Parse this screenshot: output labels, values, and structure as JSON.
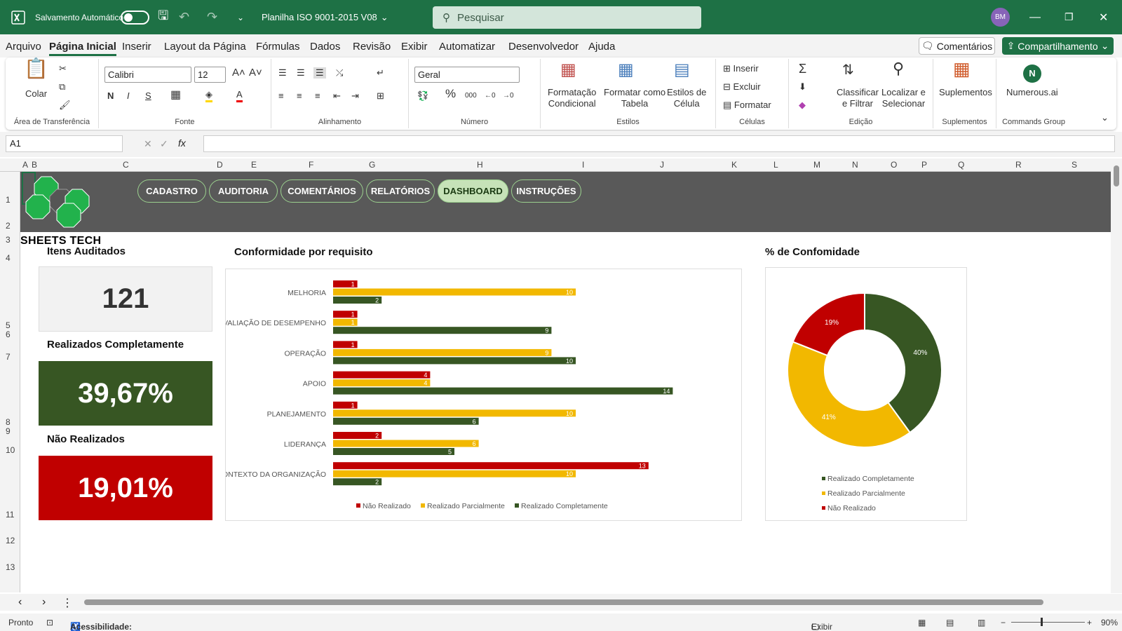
{
  "titlebar": {
    "autosave_label": "Salvamento Automático",
    "filename": "Planilha ISO 9001-2015 V08",
    "search_placeholder": "Pesquisar",
    "avatar": "BM"
  },
  "menu": [
    "Arquivo",
    "Página Inicial",
    "Inserir",
    "Layout da Página",
    "Fórmulas",
    "Dados",
    "Revisão",
    "Exibir",
    "Automatizar",
    "Desenvolvedor",
    "Ajuda"
  ],
  "menu_active": "Página Inicial",
  "comments_label": "Comentários",
  "share_label": "Compartilhamento",
  "ribbon": {
    "clipboard": {
      "paste": "Colar",
      "group": "Área de Transferência"
    },
    "font": {
      "name": "Calibri",
      "size": "12",
      "group": "Fonte",
      "bold": "N",
      "italic": "I",
      "underline": "S"
    },
    "alignment": {
      "group": "Alinhamento"
    },
    "number": {
      "format": "Geral",
      "group": "Número",
      "percent": "%",
      "thousands": "000"
    },
    "styles": {
      "cond1": "Formatação",
      "cond2": "Condicional",
      "table1": "Formatar como",
      "table2": "Tabela",
      "cell1": "Estilos de",
      "cell2": "Célula",
      "group": "Estilos"
    },
    "cells": {
      "insert": "Inserir",
      "delete": "Excluir",
      "format": "Formatar",
      "group": "Células"
    },
    "editing": {
      "sort1": "Classificar",
      "sort2": "e Filtrar",
      "find1": "Localizar e",
      "find2": "Selecionar",
      "group": "Edição"
    },
    "addins": {
      "label": "Suplementos",
      "group": "Suplementos"
    },
    "commands": {
      "label": "Numerous.ai",
      "group": "Commands Group"
    }
  },
  "formula": {
    "namebox": "A1",
    "fx": "fx"
  },
  "columns": [
    "A",
    "B",
    "C",
    "D",
    "E",
    "F",
    "G",
    "H",
    "I",
    "J",
    "K",
    "L",
    "M",
    "N",
    "O",
    "P",
    "Q",
    "R",
    "S"
  ],
  "rows": [
    "1",
    "2",
    "3",
    "4",
    "5",
    "6",
    "7",
    "8",
    "9",
    "10",
    "11",
    "12",
    "13"
  ],
  "nav": [
    "CADASTRO",
    "AUDITORIA",
    "COMENTÁRIOS",
    "RELATÓRIOS",
    "DASHBOARD",
    "INSTRUÇÕES"
  ],
  "nav_active": "DASHBOARD",
  "brand": "SHEETS TECH",
  "kpis": {
    "items_title": "Itens Auditados",
    "items_value": "121",
    "done_title": "Realizados Completamente",
    "done_value": "39,67%",
    "notdone_title": "Não Realizados",
    "notdone_value": "19,01%"
  },
  "colors": {
    "red": "#c00000",
    "yellow": "#f2b800",
    "green": "#375623",
    "titlebar": "#1e7145"
  },
  "chart_data": [
    {
      "type": "bar",
      "orientation": "horizontal",
      "title": "Conformidade por requisito",
      "categories": [
        "MELHORIA",
        "AVALIAÇÃO DE DESEMPENHO",
        "OPERAÇÃO",
        "APOIO",
        "PLANEJAMENTO",
        "LIDERANÇA",
        "CONTEXTO DA ORGANIZAÇÃO"
      ],
      "series": [
        {
          "name": "Não Realizado",
          "color": "#c00000",
          "values": [
            1,
            1,
            1,
            4,
            1,
            2,
            13
          ]
        },
        {
          "name": "Realizado Parcialmente",
          "color": "#f2b800",
          "values": [
            10,
            1,
            9,
            4,
            10,
            6,
            10
          ]
        },
        {
          "name": "Realizado Completamente",
          "color": "#375623",
          "values": [
            2,
            9,
            10,
            14,
            6,
            5,
            2
          ]
        }
      ],
      "xlim": [
        0,
        14
      ],
      "legend": "bottom"
    },
    {
      "type": "pie",
      "donut": true,
      "title": "% de Confomidade",
      "slices": [
        {
          "name": "Realizado Completamente",
          "value": 40,
          "label": "40%",
          "color": "#375623"
        },
        {
          "name": "Realizado Parcialmente",
          "value": 41,
          "label": "41%",
          "color": "#f2b800"
        },
        {
          "name": "Não Realizado",
          "value": 19,
          "label": "19%",
          "color": "#c00000"
        }
      ],
      "legend": "bottom"
    }
  ],
  "status": {
    "ready": "Pronto",
    "accessibility": "Acessibilidade: investigar",
    "settings": "Exibir Configurações",
    "zoom": "90%"
  }
}
